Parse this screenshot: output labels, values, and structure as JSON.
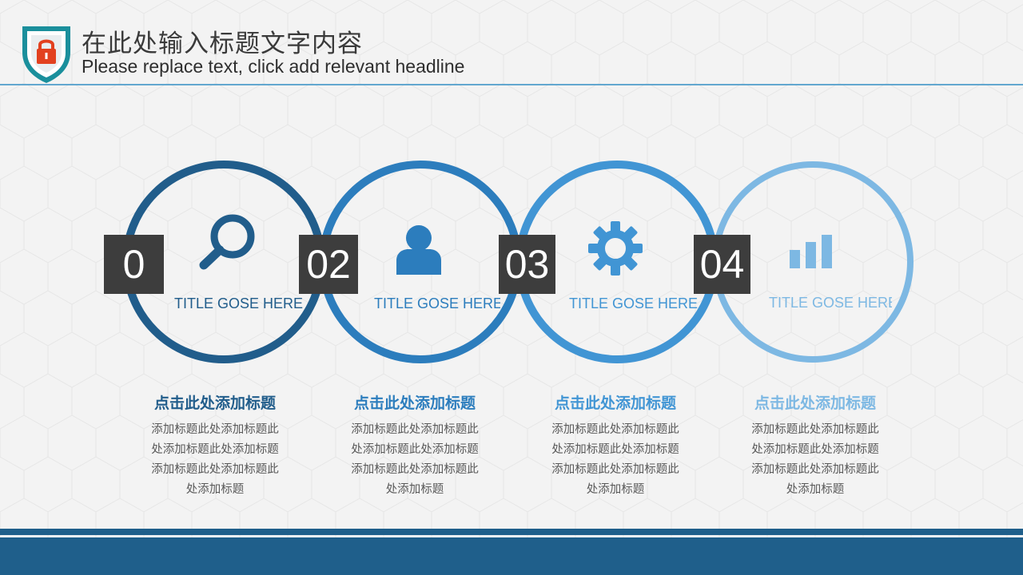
{
  "header": {
    "title": "在此处输入标题文字内容",
    "subtitle": "Please replace text, click add relevant headline"
  },
  "colors": {
    "step1": "#215d8b",
    "step2": "#2c7dbd",
    "step3": "#4195d4",
    "step4": "#7db8e3",
    "number_box": "#3d3d3d",
    "footer": "#1f5f8b",
    "logo_teal": "#1a8f9c",
    "lock": "#e2411f"
  },
  "steps": [
    {
      "number": "0",
      "icon": "search-icon",
      "caption": "TITLE GOSE HERE",
      "heading": "点击此处添加标题",
      "body_lines": [
        "添加标题此处添加标题此",
        "处添加标题此处添加标题",
        "添加标题此处添加标题此",
        "处添加标题"
      ]
    },
    {
      "number": "02",
      "icon": "user-icon",
      "caption": "TITLE GOSE HERE",
      "heading": "点击此处添加标题",
      "body_lines": [
        "添加标题此处添加标题此",
        "处添加标题此处添加标题",
        "添加标题此处添加标题此",
        "处添加标题"
      ]
    },
    {
      "number": "03",
      "icon": "gear-icon",
      "caption": "TITLE GOSE HERE",
      "heading": "点击此处添加标题",
      "body_lines": [
        "添加标题此处添加标题此",
        "处添加标题此处添加标题",
        "添加标题此处添加标题此",
        "处添加标题"
      ]
    },
    {
      "number": "04",
      "icon": "bar-chart-icon",
      "caption": "TITLE GOSE HERE",
      "heading": "点击此处添加标题",
      "body_lines": [
        "添加标题此处添加标题此",
        "处添加标题此处添加标题",
        "添加标题此处添加标题此",
        "处添加标题"
      ]
    }
  ]
}
